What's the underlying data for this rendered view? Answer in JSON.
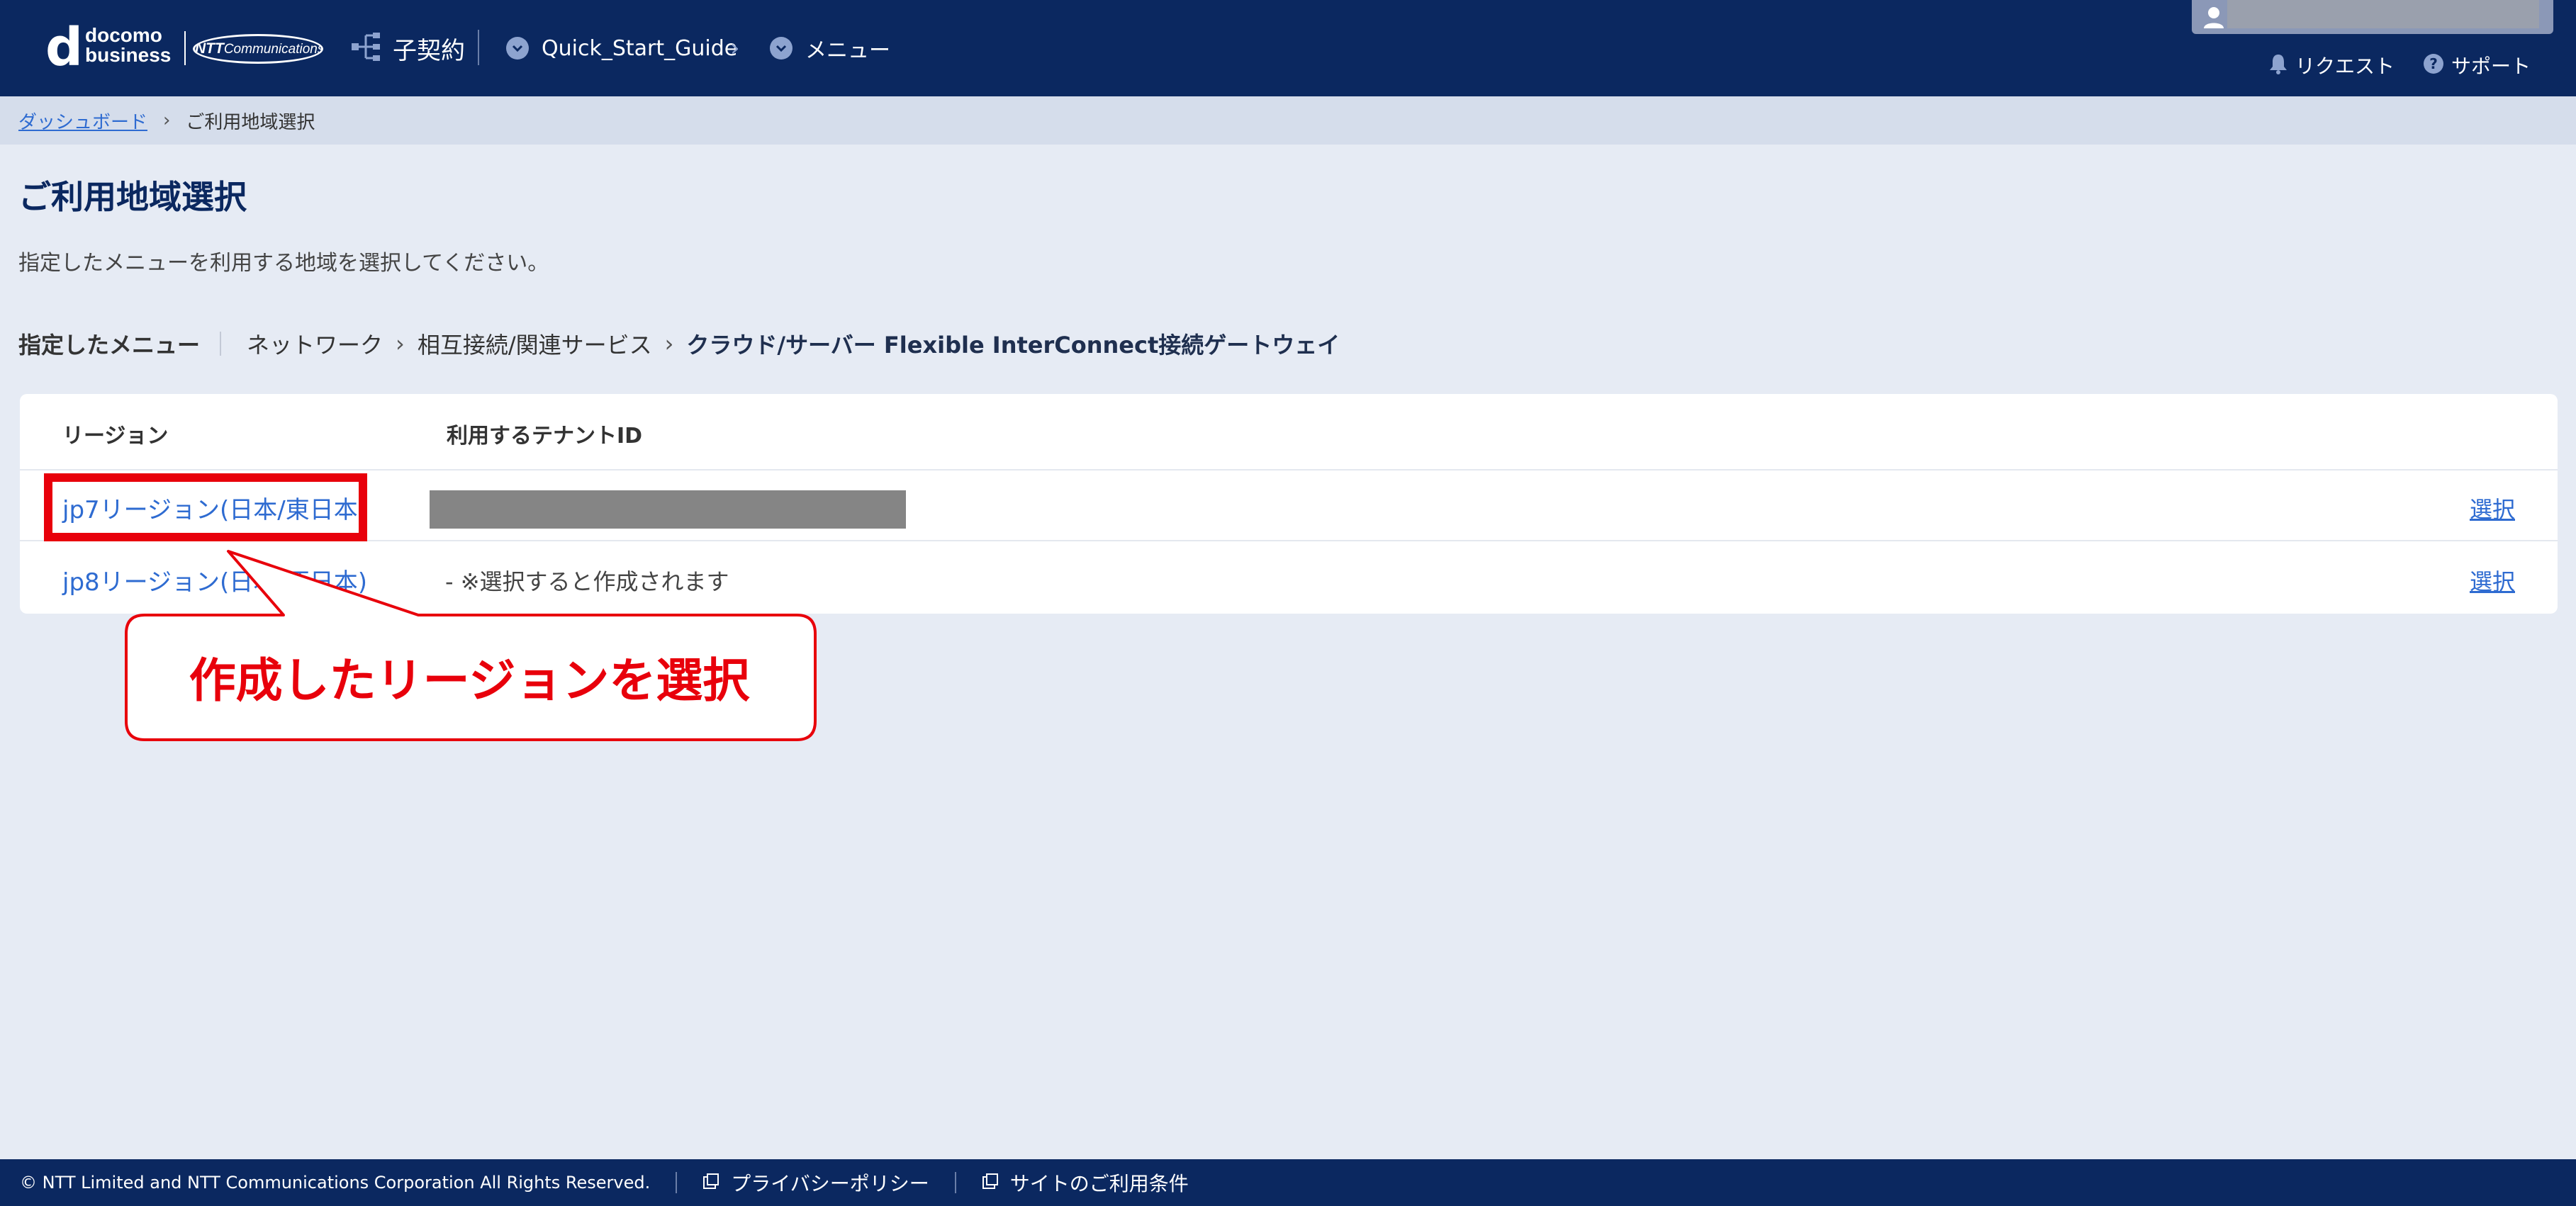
{
  "header": {
    "logo_letter": "d",
    "logo_line1": "docomo",
    "logo_line2": "business",
    "ntt_logo_main": "NTT",
    "ntt_logo_sub": "Communications",
    "child_contract": "子契約",
    "nav_items": [
      "Quick_Start_Guide",
      "メニュー"
    ],
    "links": [
      "リクエスト",
      "サポート"
    ],
    "icons": [
      "hierarchy-icon",
      "chevron-circle-icon",
      "user-icon",
      "bell-icon",
      "help-icon"
    ]
  },
  "breadcrumb": {
    "home": "ダッシュボード",
    "current": "ご利用地域選択"
  },
  "page": {
    "title": "ご利用地域選択",
    "description": "指定したメニューを利用する地域を選択してください。",
    "menu_label": "指定したメニュー",
    "menu_path": [
      "ネットワーク",
      "相互接続/関連サービス",
      "クラウド/サーバー Flexible InterConnect接続ゲートウェイ"
    ]
  },
  "table": {
    "columns": [
      "リージョン",
      "利用するテナントID"
    ],
    "rows": [
      {
        "region": "jp7リージョン(日本/東日本)",
        "tenant": "",
        "action": "選択"
      },
      {
        "region": "jp8リージョン(日本/西日本)",
        "tenant": "- ※選択すると作成されます",
        "action": "選択"
      }
    ]
  },
  "annotation": {
    "callout": "作成したリージョンを選択",
    "color": "#e8000b"
  },
  "footer": {
    "copyright": "© NTT Limited and NTT Communications Corporation All Rights Reserved.",
    "links": [
      "プライバシーポリシー",
      "サイトのご利用条件"
    ]
  },
  "colors": {
    "header_bg": "#0b2860",
    "page_bg": "#e6ebf4",
    "link": "#2e6bd1"
  }
}
